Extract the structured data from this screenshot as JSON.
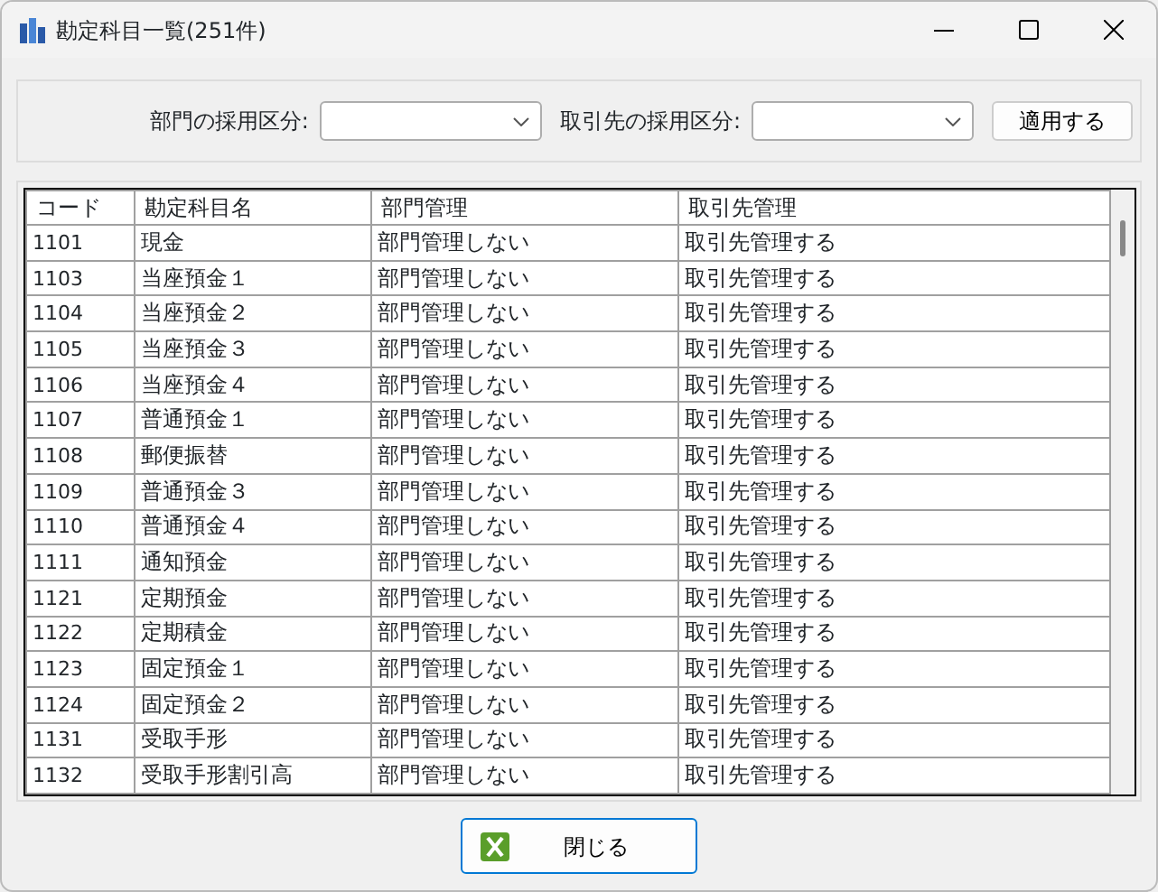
{
  "window": {
    "title": "勘定科目一覧(251件)"
  },
  "filters": [
    {
      "label": "部門の採用区分:"
    },
    {
      "label": "取引先の採用区分:"
    }
  ],
  "apply_button": "適用する",
  "table": {
    "columns": [
      "コード",
      "勘定科目名",
      "部門管理",
      "取引先管理"
    ],
    "rows": [
      [
        "1101",
        "現金",
        "部門管理しない",
        "取引先管理する"
      ],
      [
        "1103",
        "当座預金１",
        "部門管理しない",
        "取引先管理する"
      ],
      [
        "1104",
        "当座預金２",
        "部門管理しない",
        "取引先管理する"
      ],
      [
        "1105",
        "当座預金３",
        "部門管理しない",
        "取引先管理する"
      ],
      [
        "1106",
        "当座預金４",
        "部門管理しない",
        "取引先管理する"
      ],
      [
        "1107",
        "普通預金１",
        "部門管理しない",
        "取引先管理する"
      ],
      [
        "1108",
        "郵便振替",
        "部門管理しない",
        "取引先管理する"
      ],
      [
        "1109",
        "普通預金３",
        "部門管理しない",
        "取引先管理する"
      ],
      [
        "1110",
        "普通預金４",
        "部門管理しない",
        "取引先管理する"
      ],
      [
        "1111",
        "通知預金",
        "部門管理しない",
        "取引先管理する"
      ],
      [
        "1121",
        "定期預金",
        "部門管理しない",
        "取引先管理する"
      ],
      [
        "1122",
        "定期積金",
        "部門管理しない",
        "取引先管理する"
      ],
      [
        "1123",
        "固定預金１",
        "部門管理しない",
        "取引先管理する"
      ],
      [
        "1124",
        "固定預金２",
        "部門管理しない",
        "取引先管理する"
      ],
      [
        "1131",
        "受取手形",
        "部門管理しない",
        "取引先管理する"
      ],
      [
        "1132",
        "受取手形割引高",
        "部門管理しない",
        "取引先管理する"
      ]
    ]
  },
  "close_button": "閉じる"
}
